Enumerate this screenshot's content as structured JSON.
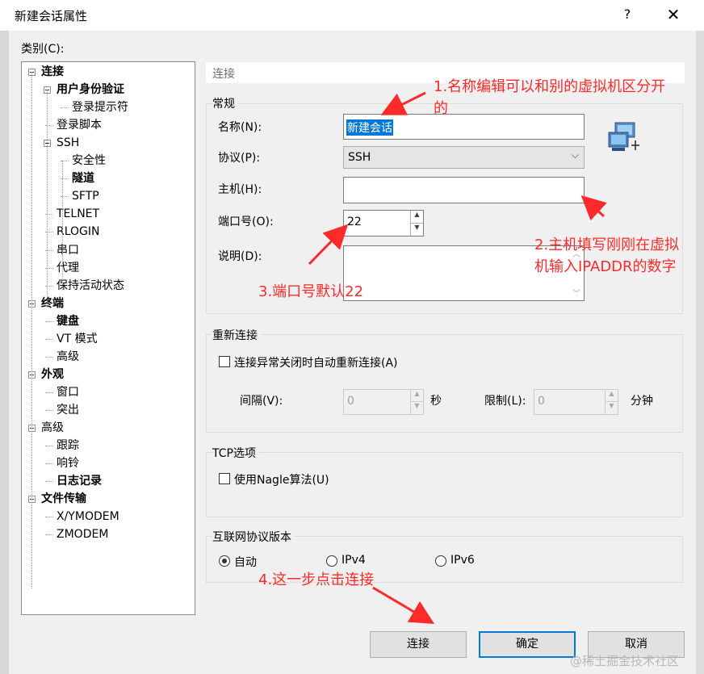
{
  "window": {
    "title": "新建会话属性",
    "help": "?",
    "close": "✕"
  },
  "category_label": "类别(C):",
  "tree": [
    {
      "label": "连接",
      "bold": true
    },
    {
      "label": "用户身份验证",
      "bold": true
    },
    {
      "label": "登录提示符",
      "bold": false
    },
    {
      "label": "登录脚本",
      "bold": false
    },
    {
      "label": "SSH",
      "bold": false
    },
    {
      "label": "安全性",
      "bold": false
    },
    {
      "label": "隧道",
      "bold": true
    },
    {
      "label": "SFTP",
      "bold": false
    },
    {
      "label": "TELNET",
      "bold": false
    },
    {
      "label": "RLOGIN",
      "bold": false
    },
    {
      "label": "串口",
      "bold": false
    },
    {
      "label": "代理",
      "bold": false
    },
    {
      "label": "保持活动状态",
      "bold": false
    },
    {
      "label": "终端",
      "bold": true
    },
    {
      "label": "键盘",
      "bold": true
    },
    {
      "label": "VT 模式",
      "bold": false
    },
    {
      "label": "高级",
      "bold": false
    },
    {
      "label": "外观",
      "bold": true
    },
    {
      "label": "窗口",
      "bold": false
    },
    {
      "label": "突出",
      "bold": false
    },
    {
      "label": "高级",
      "bold": false
    },
    {
      "label": "跟踪",
      "bold": false
    },
    {
      "label": "响铃",
      "bold": false
    },
    {
      "label": "日志记录",
      "bold": true
    },
    {
      "label": "文件传输",
      "bold": true
    },
    {
      "label": "X/YMODEM",
      "bold": false
    },
    {
      "label": "ZMODEM",
      "bold": false
    }
  ],
  "panel_header": "连接",
  "general": {
    "title": "常规",
    "name_label": "名称(N):",
    "name_value": "新建会话",
    "protocol_label": "协议(P):",
    "protocol_value": "SSH",
    "host_label": "主机(H):",
    "host_value": "",
    "port_label": "端口号(O):",
    "port_value": "22",
    "desc_label": "说明(D):",
    "desc_value": ""
  },
  "reconnect": {
    "title": "重新连接",
    "checkbox_label": "连接异常关闭时自动重新连接(A)",
    "interval_label": "间隔(V):",
    "interval_value": "0",
    "interval_unit": "秒",
    "limit_label": "限制(L):",
    "limit_value": "0",
    "limit_unit": "分钟"
  },
  "tcp": {
    "title": "TCP选项",
    "nagle_label": "使用Nagle算法(U)"
  },
  "ipver": {
    "title": "互联网协议版本",
    "auto": "自动",
    "ipv4": "IPv4",
    "ipv6": "IPv6"
  },
  "buttons": {
    "connect": "连接",
    "ok": "确定",
    "cancel": "取消"
  },
  "annotations": {
    "a1_line1": "1.名称编辑可以和别的虚拟机区分开",
    "a1_line2": "的",
    "a2_line1": "2.主机填写刚刚在虚拟",
    "a2_line2": "机输入IPADDR的数字",
    "a3": "3.端口号默认22",
    "a4": "4.这一步点击连接"
  },
  "watermark": "@稀土掘金技术社区",
  "colors": {
    "accent": "#0078d7",
    "annotation": "#ff2a2a"
  }
}
